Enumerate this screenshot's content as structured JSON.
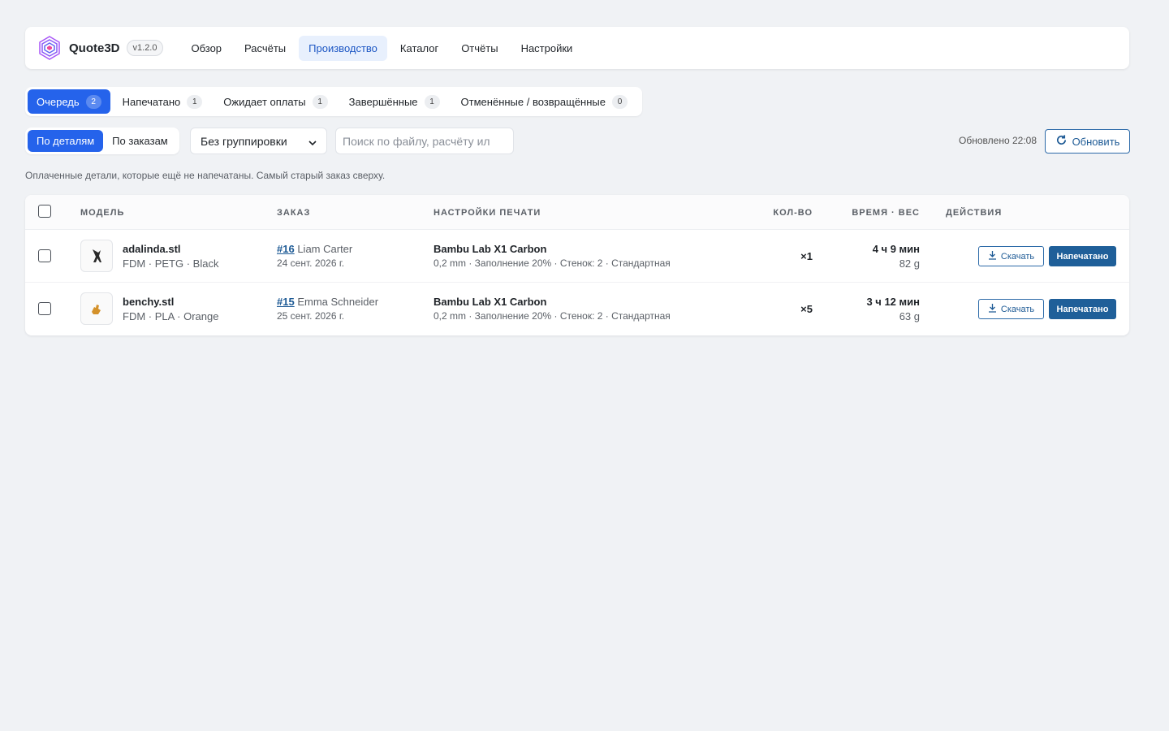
{
  "app": {
    "name": "Quote3D",
    "version": "v1.2.0"
  },
  "nav": [
    "Обзор",
    "Расчёты",
    "Производство",
    "Каталог",
    "Отчёты",
    "Настройки"
  ],
  "tabs": [
    {
      "label": "Очередь",
      "count": "2"
    },
    {
      "label": "Напечатано",
      "count": "1"
    },
    {
      "label": "Ожидает оплаты",
      "count": "1"
    },
    {
      "label": "Завершённые",
      "count": "1"
    },
    {
      "label": "Отменённые / возвращённые",
      "count": "0"
    }
  ],
  "view_toggle": {
    "by_parts": "По деталям",
    "by_orders": "По заказам"
  },
  "grouping": {
    "selected": "Без группировки"
  },
  "search": {
    "placeholder": "Поиск по файлу, расчёту ил"
  },
  "updated": "Обновлено 22:08",
  "refresh_label": "Обновить",
  "hint": "Оплаченные детали, которые ещё не напечатаны. Самый старый заказ сверху.",
  "columns": {
    "model": "МОДЕЛЬ",
    "order": "ЗАКАЗ",
    "print_settings": "НАСТРОЙКИ ПЕЧАТИ",
    "qty": "КОЛ-ВО",
    "time_weight": "ВРЕМЯ · ВЕС",
    "actions": "ДЕЙСТВИЯ"
  },
  "rows": [
    {
      "file": "adalinda.stl",
      "meta": "FDM · PETG · Black",
      "order_id": "#16",
      "customer": "Liam Carter",
      "date": "24 сент. 2026 г.",
      "printer": "Bambu Lab X1 Carbon",
      "settings": "0,2 mm · Заполнение 20% · Стенок: 2 · Стандартная",
      "qty": "×1",
      "time": "4 ч 9 мин",
      "weight": "82 g",
      "download": "Скачать",
      "printed": "Напечатано"
    },
    {
      "file": "benchy.stl",
      "meta": "FDM · PLA · Orange",
      "order_id": "#15",
      "customer": "Emma Schneider",
      "date": "25 сент. 2026 г.",
      "printer": "Bambu Lab X1 Carbon",
      "settings": "0,2 mm · Заполнение 20% · Стенок: 2 · Стандартная",
      "qty": "×5",
      "time": "3 ч 12 мин",
      "weight": "63 g",
      "download": "Скачать",
      "printed": "Напечатано"
    }
  ],
  "colors": {
    "accent": "#2563eb",
    "nav_active_bg": "#e8f0fd",
    "primary_button": "#1f5f99"
  }
}
